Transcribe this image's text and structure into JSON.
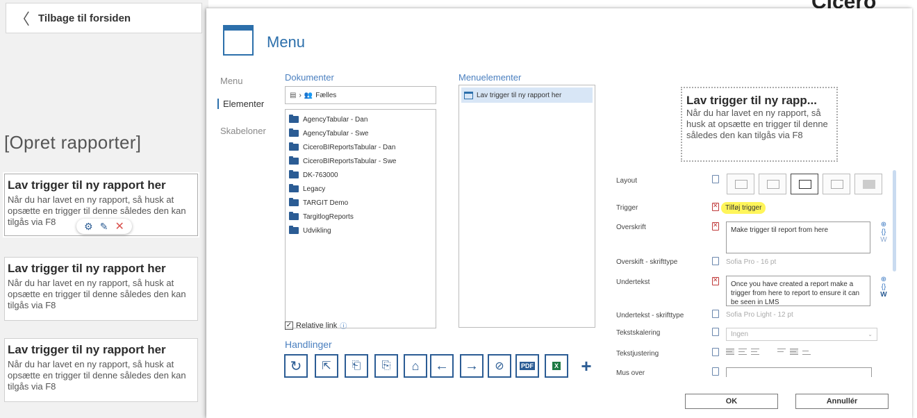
{
  "background": {
    "back_label": "Tilbage til forsiden",
    "title": "[Opret rapporter]",
    "logo_text": "Cicero Exp",
    "cards": [
      {
        "title": "Lav trigger til ny rapport her",
        "text": "Når du har lavet en ny rapport, så husk at opsætte en trigger til denne således den kan tilgås via F8"
      },
      {
        "title": "Lav trigger til ny rapport her",
        "text": "Når du har lavet en ny rapport, så husk at opsætte en trigger til denne således den kan tilgås via F8"
      },
      {
        "title": "Lav trigger til ny rapport her",
        "text": "Når du har lavet en ny rapport, så husk at opsætte en trigger til denne således den kan tilgås via F8"
      }
    ]
  },
  "dialog": {
    "title": "Menu",
    "sidebar": [
      "Menu",
      "Elementer",
      "Skabeloner"
    ],
    "documents_heading": "Dokumenter",
    "path": "Fælles",
    "documents": [
      "AgencyTabular - Dan",
      "AgencyTabular - Swe",
      "CiceroBIReportsTabular - Dan",
      "CiceroBIReportsTabular - Swe",
      "DK-763000",
      "Legacy",
      "TARGIT Demo",
      "TargitlogReports",
      "Udvikling"
    ],
    "relative_link": "Relative link",
    "actions_heading": "Handlinger",
    "menu_heading": "Menuelementer",
    "menu_items": [
      "Lav trigger til ny rapport her"
    ],
    "preview": {
      "title": "Lav trigger til ny rapp...",
      "text": "Når du har lavet en ny rapport, så husk at opsætte en trigger til denne således den kan tilgås via F8"
    },
    "props": {
      "layout": "Layout",
      "trigger": "Trigger",
      "trigger_value": "Tilføj trigger",
      "heading": "Overskrift",
      "heading_value": "Make trigger til report from here",
      "heading_font": "Overskift - skrifttype",
      "heading_font_value": "Sofia Pro - 16 pt",
      "subtext": "Undertekst",
      "subtext_value": "Once you have created a report make a trigger from here to report to ensure it can be seen in LMS",
      "subtext_font": "Undertekst - skrifttype",
      "subtext_font_value": "Sofia Pro Light - 12 pt",
      "scaling": "Tekstskalering",
      "scaling_value": "Ingen",
      "alignment": "Tekstjustering",
      "mouse_over": "Mus over"
    },
    "ok": "OK",
    "cancel": "Annullér"
  }
}
